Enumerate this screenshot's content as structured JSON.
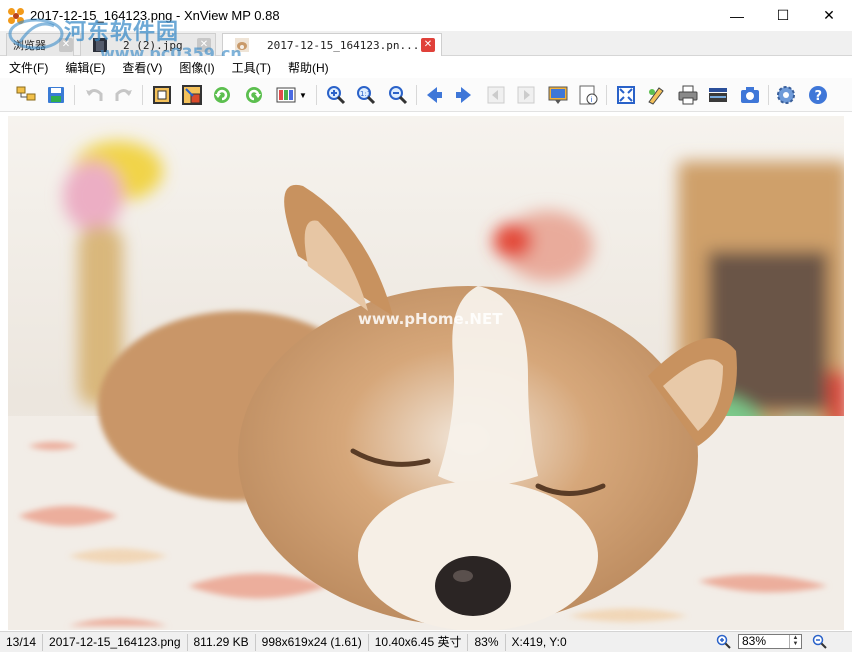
{
  "window": {
    "title": "2017-12-15_164123.png - XnView MP 0.88",
    "controls": {
      "minimize": "—",
      "maximize": "☐",
      "close": "✕"
    }
  },
  "tabs": [
    {
      "label": "浏览器",
      "state": "inactive"
    },
    {
      "label": "2 (2).jpg",
      "state": "inactive"
    },
    {
      "label": "2017-12-15_164123.pn...",
      "state": "active"
    }
  ],
  "watermark": {
    "site_name": "河东软件园",
    "site_url": "www.pc0359.cn",
    "image_watermark": "www.pHome.NET"
  },
  "menu": [
    "文件(F)",
    "编辑(E)",
    "查看(V)",
    "图像(I)",
    "工具(T)",
    "帮助(H)"
  ],
  "toolbar": [
    "browse-icon",
    "save-icon",
    "undo-icon",
    "redo-icon",
    "crop-icon",
    "resize-icon",
    "rotate-left-icon",
    "rotate-right-icon",
    "adjust-colors-icon",
    "zoom-in-icon",
    "zoom-1to1-icon",
    "zoom-out-icon",
    "previous-icon",
    "next-icon",
    "first-icon",
    "last-icon",
    "slideshow-icon",
    "info-icon",
    "fullscreen-icon",
    "edit-icon",
    "print-icon",
    "scan-icon",
    "capture-icon",
    "settings-icon",
    "help-icon"
  ],
  "status": {
    "position": "13/14",
    "filename": "2017-12-15_164123.png",
    "filesize": "811.29 KB",
    "dimensions": "998x619x24 (1.61)",
    "print_size": "10.40x6.45 英寸",
    "zoom_percent": "83%",
    "cursor": "X:419, Y:0",
    "zoom_value": "83%"
  },
  "colors": {
    "accent_blue": "#2a62c9",
    "close_red": "#e0413a",
    "status_bg": "#f0f0f0"
  }
}
